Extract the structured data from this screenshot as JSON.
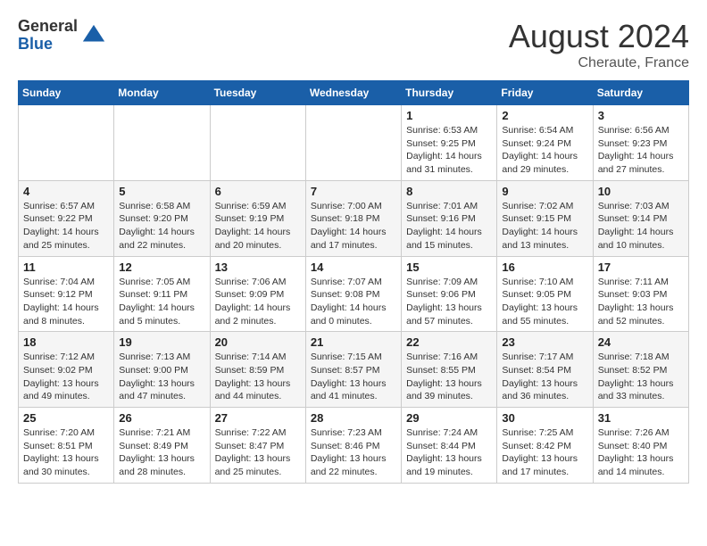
{
  "logo": {
    "general": "General",
    "blue": "Blue"
  },
  "title": "August 2024",
  "location": "Cheraute, France",
  "days_header": [
    "Sunday",
    "Monday",
    "Tuesday",
    "Wednesday",
    "Thursday",
    "Friday",
    "Saturday"
  ],
  "weeks": [
    [
      {
        "day": "",
        "info": ""
      },
      {
        "day": "",
        "info": ""
      },
      {
        "day": "",
        "info": ""
      },
      {
        "day": "",
        "info": ""
      },
      {
        "day": "1",
        "info": "Sunrise: 6:53 AM\nSunset: 9:25 PM\nDaylight: 14 hours\nand 31 minutes."
      },
      {
        "day": "2",
        "info": "Sunrise: 6:54 AM\nSunset: 9:24 PM\nDaylight: 14 hours\nand 29 minutes."
      },
      {
        "day": "3",
        "info": "Sunrise: 6:56 AM\nSunset: 9:23 PM\nDaylight: 14 hours\nand 27 minutes."
      }
    ],
    [
      {
        "day": "4",
        "info": "Sunrise: 6:57 AM\nSunset: 9:22 PM\nDaylight: 14 hours\nand 25 minutes."
      },
      {
        "day": "5",
        "info": "Sunrise: 6:58 AM\nSunset: 9:20 PM\nDaylight: 14 hours\nand 22 minutes."
      },
      {
        "day": "6",
        "info": "Sunrise: 6:59 AM\nSunset: 9:19 PM\nDaylight: 14 hours\nand 20 minutes."
      },
      {
        "day": "7",
        "info": "Sunrise: 7:00 AM\nSunset: 9:18 PM\nDaylight: 14 hours\nand 17 minutes."
      },
      {
        "day": "8",
        "info": "Sunrise: 7:01 AM\nSunset: 9:16 PM\nDaylight: 14 hours\nand 15 minutes."
      },
      {
        "day": "9",
        "info": "Sunrise: 7:02 AM\nSunset: 9:15 PM\nDaylight: 14 hours\nand 13 minutes."
      },
      {
        "day": "10",
        "info": "Sunrise: 7:03 AM\nSunset: 9:14 PM\nDaylight: 14 hours\nand 10 minutes."
      }
    ],
    [
      {
        "day": "11",
        "info": "Sunrise: 7:04 AM\nSunset: 9:12 PM\nDaylight: 14 hours\nand 8 minutes."
      },
      {
        "day": "12",
        "info": "Sunrise: 7:05 AM\nSunset: 9:11 PM\nDaylight: 14 hours\nand 5 minutes."
      },
      {
        "day": "13",
        "info": "Sunrise: 7:06 AM\nSunset: 9:09 PM\nDaylight: 14 hours\nand 2 minutes."
      },
      {
        "day": "14",
        "info": "Sunrise: 7:07 AM\nSunset: 9:08 PM\nDaylight: 14 hours\nand 0 minutes."
      },
      {
        "day": "15",
        "info": "Sunrise: 7:09 AM\nSunset: 9:06 PM\nDaylight: 13 hours\nand 57 minutes."
      },
      {
        "day": "16",
        "info": "Sunrise: 7:10 AM\nSunset: 9:05 PM\nDaylight: 13 hours\nand 55 minutes."
      },
      {
        "day": "17",
        "info": "Sunrise: 7:11 AM\nSunset: 9:03 PM\nDaylight: 13 hours\nand 52 minutes."
      }
    ],
    [
      {
        "day": "18",
        "info": "Sunrise: 7:12 AM\nSunset: 9:02 PM\nDaylight: 13 hours\nand 49 minutes."
      },
      {
        "day": "19",
        "info": "Sunrise: 7:13 AM\nSunset: 9:00 PM\nDaylight: 13 hours\nand 47 minutes."
      },
      {
        "day": "20",
        "info": "Sunrise: 7:14 AM\nSunset: 8:59 PM\nDaylight: 13 hours\nand 44 minutes."
      },
      {
        "day": "21",
        "info": "Sunrise: 7:15 AM\nSunset: 8:57 PM\nDaylight: 13 hours\nand 41 minutes."
      },
      {
        "day": "22",
        "info": "Sunrise: 7:16 AM\nSunset: 8:55 PM\nDaylight: 13 hours\nand 39 minutes."
      },
      {
        "day": "23",
        "info": "Sunrise: 7:17 AM\nSunset: 8:54 PM\nDaylight: 13 hours\nand 36 minutes."
      },
      {
        "day": "24",
        "info": "Sunrise: 7:18 AM\nSunset: 8:52 PM\nDaylight: 13 hours\nand 33 minutes."
      }
    ],
    [
      {
        "day": "25",
        "info": "Sunrise: 7:20 AM\nSunset: 8:51 PM\nDaylight: 13 hours\nand 30 minutes."
      },
      {
        "day": "26",
        "info": "Sunrise: 7:21 AM\nSunset: 8:49 PM\nDaylight: 13 hours\nand 28 minutes."
      },
      {
        "day": "27",
        "info": "Sunrise: 7:22 AM\nSunset: 8:47 PM\nDaylight: 13 hours\nand 25 minutes."
      },
      {
        "day": "28",
        "info": "Sunrise: 7:23 AM\nSunset: 8:46 PM\nDaylight: 13 hours\nand 22 minutes."
      },
      {
        "day": "29",
        "info": "Sunrise: 7:24 AM\nSunset: 8:44 PM\nDaylight: 13 hours\nand 19 minutes."
      },
      {
        "day": "30",
        "info": "Sunrise: 7:25 AM\nSunset: 8:42 PM\nDaylight: 13 hours\nand 17 minutes."
      },
      {
        "day": "31",
        "info": "Sunrise: 7:26 AM\nSunset: 8:40 PM\nDaylight: 13 hours\nand 14 minutes."
      }
    ]
  ]
}
